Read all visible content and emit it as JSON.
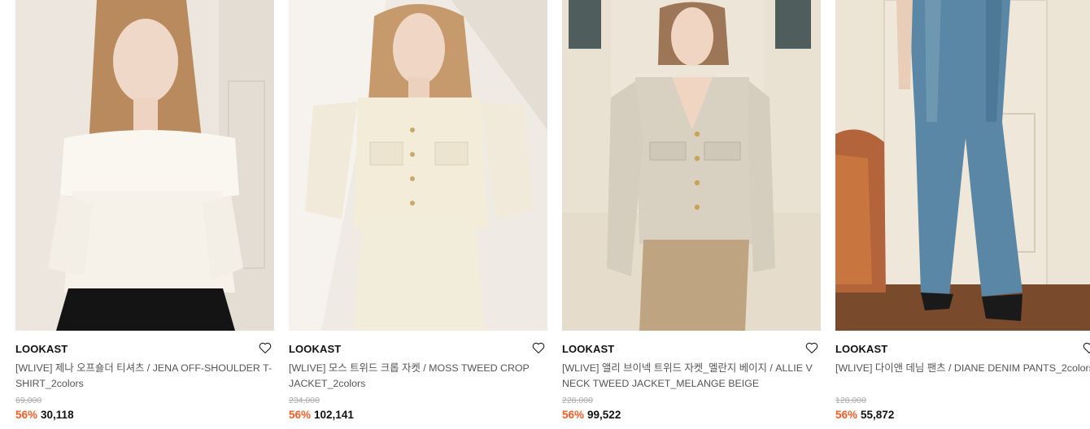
{
  "products": [
    {
      "brand": "LOOKAST",
      "name": "[WLIVE] 제나 오프숄더 티셔츠 / JENA OFF-SHOULDER T-SHIRT_2colors",
      "original_price": "69,000",
      "discount": "56%",
      "price": "30,118",
      "image": "model-white-off-shoulder-top"
    },
    {
      "brand": "LOOKAST",
      "name": "[WLIVE] 모스 트위드 크롭 자켓 / MOSS TWEED CROP JACKET_2colors",
      "original_price": "234,000",
      "discount": "56%",
      "price": "102,141",
      "image": "model-cream-tweed-crop-jacket"
    },
    {
      "brand": "LOOKAST",
      "name": "[WLIVE] 앨리 브이넥 트위드 자켓_멜란지 베이지 / ALLIE V NECK TWEED JACKET_MELANGE BEIGE",
      "original_price": "228,000",
      "discount": "56%",
      "price": "99,522",
      "image": "model-beige-vneck-tweed-jacket"
    },
    {
      "brand": "LOOKAST",
      "name": "[WLIVE] 다이앤 데님 팬츠 / DIANE DENIM PANTS_2colors",
      "original_price": "128,000",
      "discount": "56%",
      "price": "55,872",
      "image": "model-blue-denim-pants"
    }
  ],
  "icons": {
    "wishlist": "heart-outline-icon"
  },
  "colors": {
    "discount": "#ff5a1f",
    "brand": "#111111",
    "name": "#555555",
    "original_price": "#aaaaaa"
  }
}
